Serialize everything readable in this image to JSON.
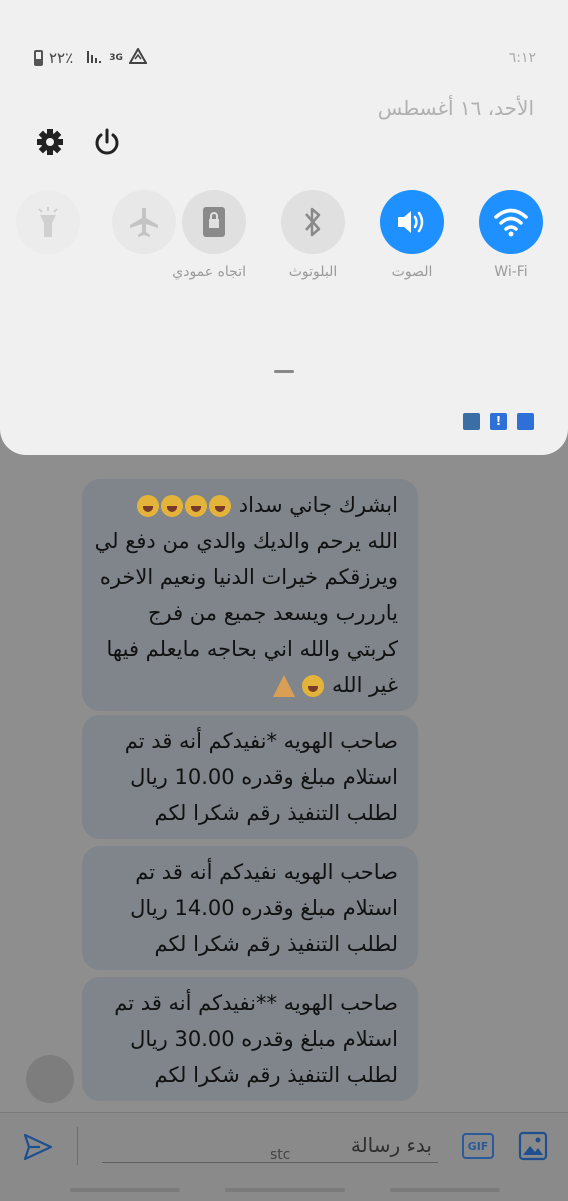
{
  "status_bar": {
    "battery_text": "٢٢٪",
    "network_type": "3G",
    "time": "٦:١٢"
  },
  "quick_settings": {
    "date": "الأحد، ١٦ أغسطس",
    "tiles": [
      {
        "name": "wifi",
        "label": "Wi-Fi",
        "active": true
      },
      {
        "name": "sound",
        "label": "الصوت",
        "active": true
      },
      {
        "name": "bluetooth",
        "label": "البلوتوث",
        "active": false
      },
      {
        "name": "portrait",
        "label": "اتجاه عمودي",
        "active": false
      },
      {
        "name": "airplane",
        "label": "",
        "active": false
      },
      {
        "name": "flashlight",
        "label": "",
        "active": false
      }
    ],
    "active_color": "#1e90ff"
  },
  "messages": [
    {
      "lines": [
        "ابشرك جاني سداد",
        "الله يرحم والديك والدي من دفع لي",
        "ويرزقكم خيرات الدنيا ونعيم الاخره",
        "يارررب ويسعد جميع من فرج",
        "كربتي والله اني بحاجه مايعلم فيها",
        "غير الله"
      ]
    },
    {
      "lines": [
        "صاحب الهويه *نفيدكم أنه قد تم",
        "استلام مبلغ وقدره 10.00 ريال",
        "لطلب التنفيذ رقم  شكرا لكم"
      ]
    },
    {
      "lines": [
        "صاحب الهويه نفيدكم أنه قد تم",
        "استلام مبلغ وقدره 14.00 ريال",
        "لطلب التنفيذ رقم  شكرا لكم"
      ]
    },
    {
      "lines": [
        "صاحب الهويه **نفيدكم أنه قد تم",
        "استلام مبلغ وقدره 30.00 ريال",
        "لطلب التنفيذ رقم  شكرا لكم"
      ]
    }
  ],
  "composer": {
    "placeholder": "بدء رسالة",
    "sim_label": "stc",
    "gif_label": "GIF"
  }
}
